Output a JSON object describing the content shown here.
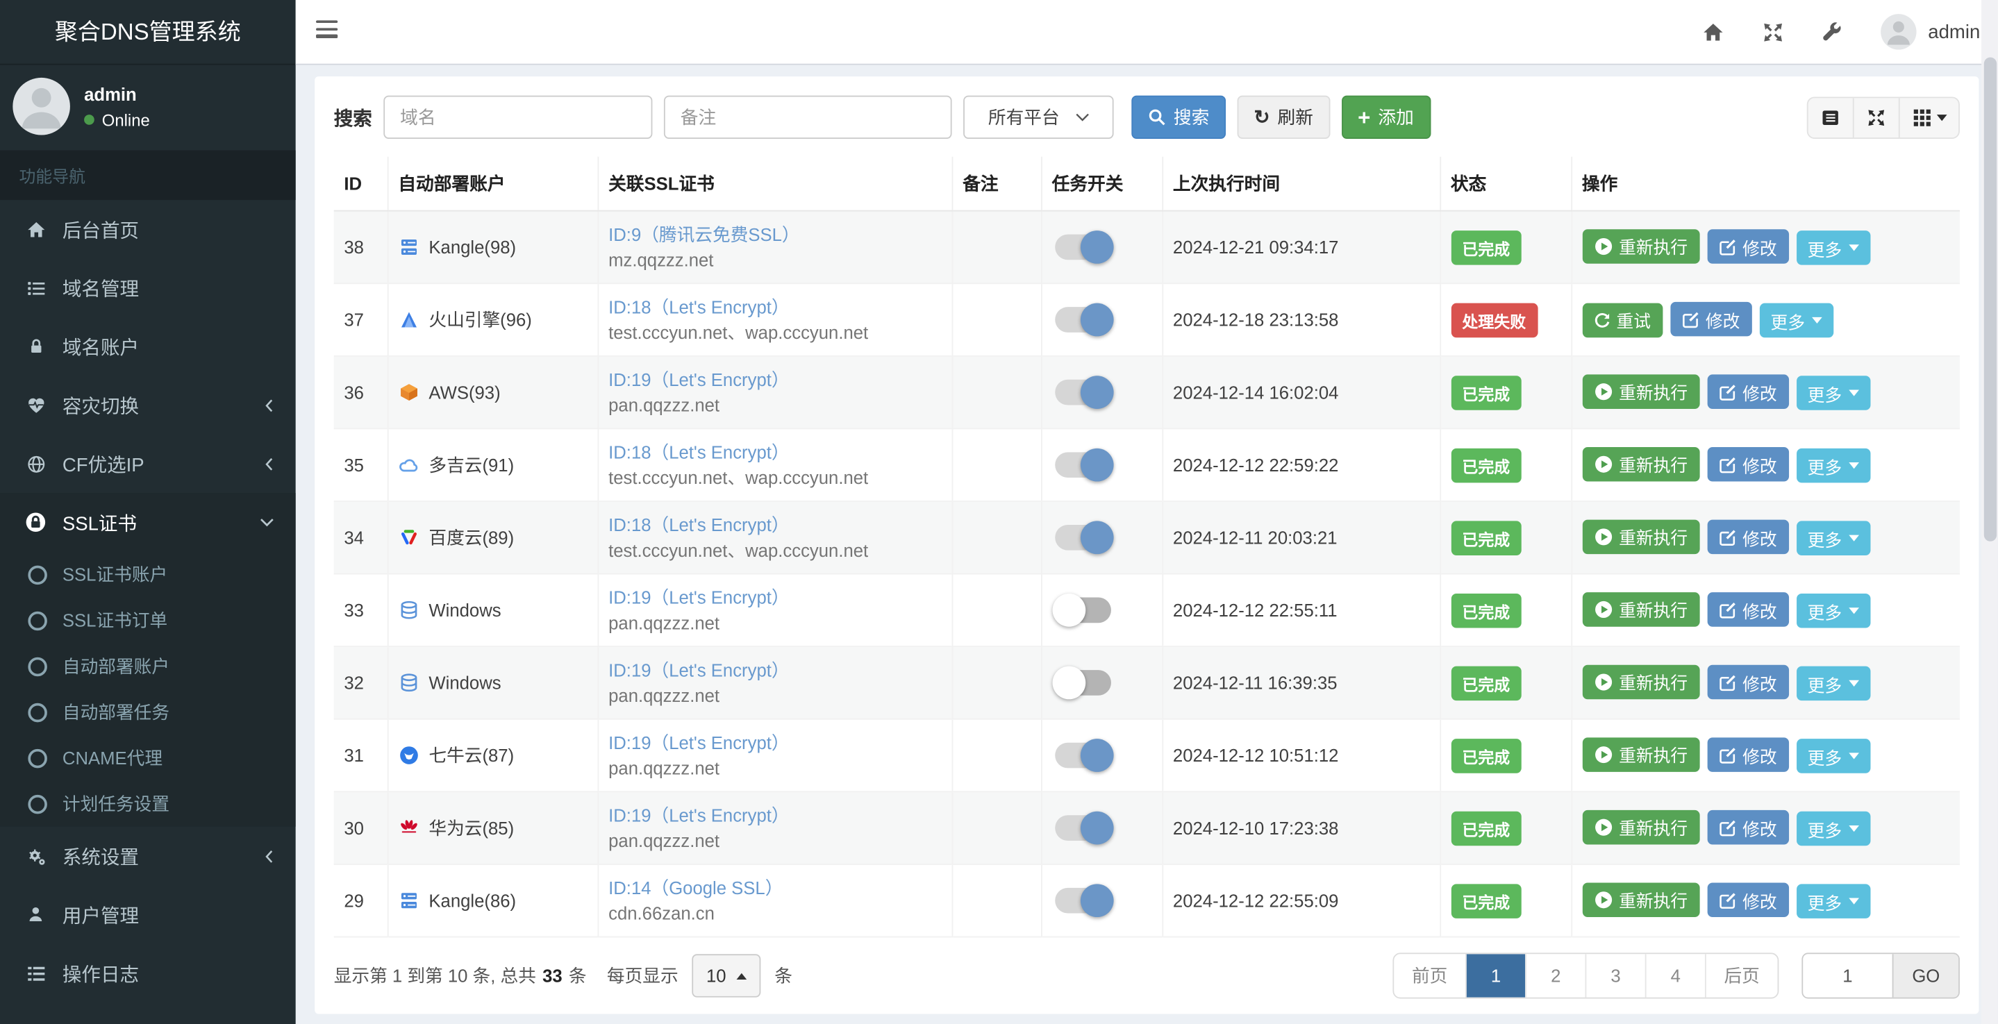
{
  "app": {
    "title": "聚合DNS管理系统"
  },
  "topbar": {
    "username": "admin",
    "icons": [
      "home",
      "fullscreen",
      "wrench"
    ]
  },
  "sidebar": {
    "user": {
      "name": "admin",
      "status": "Online"
    },
    "section_label": "功能导航",
    "items": [
      {
        "label": "后台首页",
        "icon": "home"
      },
      {
        "label": "域名管理",
        "icon": "list"
      },
      {
        "label": "域名账户",
        "icon": "lock"
      },
      {
        "label": "容灾切换",
        "icon": "heartbeat",
        "chevron": "left"
      },
      {
        "label": "CF优选IP",
        "icon": "globe",
        "chevron": "left"
      },
      {
        "label": "SSL证书",
        "icon": "ssl-lock",
        "chevron": "down",
        "active": true,
        "children": [
          "SSL证书账户",
          "SSL证书订单",
          "自动部署账户",
          "自动部署任务",
          "CNAME代理",
          "计划任务设置"
        ]
      },
      {
        "label": "系统设置",
        "icon": "gears",
        "chevron": "left"
      },
      {
        "label": "用户管理",
        "icon": "user"
      },
      {
        "label": "操作日志",
        "icon": "log"
      }
    ]
  },
  "search": {
    "label": "搜索",
    "domain_placeholder": "域名",
    "note_placeholder": "备注",
    "platform_selected": "所有平台",
    "search_button": "搜索",
    "refresh_button": "刷新",
    "add_button": "添加"
  },
  "view_toolbar": {
    "buttons": [
      "detail-view",
      "fullscreen",
      "columns"
    ]
  },
  "colors": {
    "success": "#5cb85c",
    "danger": "#d9534f",
    "info": "#5bc0de",
    "primary": "#5d8fc4",
    "link": "#6899ce",
    "active_page": "#3c6e9f"
  },
  "table": {
    "columns": [
      "ID",
      "自动部署账户",
      "关联SSL证书",
      "备注",
      "任务开关",
      "上次执行时间",
      "状态",
      "操作"
    ],
    "action_sets": {
      "default": [
        {
          "label": "重新执行",
          "style": "success",
          "icon": "play-circle",
          "name": "rerun-button"
        },
        {
          "label": "修改",
          "style": "primary",
          "icon": "edit",
          "name": "edit-button"
        },
        {
          "label": "更多",
          "style": "info",
          "icon": "caret-down",
          "name": "more-button"
        }
      ],
      "retry": [
        {
          "label": "重试",
          "style": "success",
          "icon": "refresh",
          "name": "retry-button"
        },
        {
          "label": "修改",
          "style": "primary",
          "icon": "edit",
          "name": "edit-button"
        },
        {
          "label": "更多",
          "style": "info",
          "icon": "caret-down",
          "name": "more-button"
        }
      ]
    },
    "rows": [
      {
        "id": "38",
        "account": "Kangle(98)",
        "account_icon": "kangle",
        "cert_link": "ID:9（腾讯云免费SSL）",
        "cert_domains": "mz.qqzzz.net",
        "note": "",
        "switch_on": true,
        "last_run": "2024-12-21 09:34:17",
        "status": "已完成",
        "status_type": "success",
        "actions": "default"
      },
      {
        "id": "37",
        "account": "火山引擎(96)",
        "account_icon": "volcengine",
        "cert_link": "ID:18（Let's Encrypt）",
        "cert_domains": "test.cccyun.net、wap.cccyun.net",
        "note": "",
        "switch_on": true,
        "last_run": "2024-12-18 23:13:58",
        "status": "处理失败",
        "status_type": "danger",
        "actions": "retry"
      },
      {
        "id": "36",
        "account": "AWS(93)",
        "account_icon": "aws",
        "cert_link": "ID:19（Let's Encrypt）",
        "cert_domains": "pan.qqzzz.net",
        "note": "",
        "switch_on": true,
        "last_run": "2024-12-14 16:02:04",
        "status": "已完成",
        "status_type": "success",
        "actions": "default"
      },
      {
        "id": "35",
        "account": "多吉云(91)",
        "account_icon": "dogecloud",
        "cert_link": "ID:18（Let's Encrypt）",
        "cert_domains": "test.cccyun.net、wap.cccyun.net",
        "note": "",
        "switch_on": true,
        "last_run": "2024-12-12 22:59:22",
        "status": "已完成",
        "status_type": "success",
        "actions": "default"
      },
      {
        "id": "34",
        "account": "百度云(89)",
        "account_icon": "baidu",
        "cert_link": "ID:18（Let's Encrypt）",
        "cert_domains": "test.cccyun.net、wap.cccyun.net",
        "note": "",
        "switch_on": true,
        "last_run": "2024-12-11 20:03:21",
        "status": "已完成",
        "status_type": "success",
        "actions": "default"
      },
      {
        "id": "33",
        "account": "Windows",
        "account_icon": "windows-db",
        "cert_link": "ID:19（Let's Encrypt）",
        "cert_domains": "pan.qqzzz.net",
        "note": "",
        "switch_on": false,
        "last_run": "2024-12-12 22:55:11",
        "status": "已完成",
        "status_type": "success",
        "actions": "default"
      },
      {
        "id": "32",
        "account": "Windows",
        "account_icon": "windows-db",
        "cert_link": "ID:19（Let's Encrypt）",
        "cert_domains": "pan.qqzzz.net",
        "note": "",
        "switch_on": false,
        "last_run": "2024-12-11 16:39:35",
        "status": "已完成",
        "status_type": "success",
        "actions": "default"
      },
      {
        "id": "31",
        "account": "七牛云(87)",
        "account_icon": "qiniu",
        "cert_link": "ID:19（Let's Encrypt）",
        "cert_domains": "pan.qqzzz.net",
        "note": "",
        "switch_on": true,
        "last_run": "2024-12-12 10:51:12",
        "status": "已完成",
        "status_type": "success",
        "actions": "default"
      },
      {
        "id": "30",
        "account": "华为云(85)",
        "account_icon": "huawei",
        "cert_link": "ID:19（Let's Encrypt）",
        "cert_domains": "pan.qqzzz.net",
        "note": "",
        "switch_on": true,
        "last_run": "2024-12-10 17:23:38",
        "status": "已完成",
        "status_type": "success",
        "actions": "default"
      },
      {
        "id": "29",
        "account": "Kangle(86)",
        "account_icon": "kangle",
        "cert_link": "ID:14（Google SSL）",
        "cert_domains": "cdn.66zan.cn",
        "note": "",
        "switch_on": true,
        "last_run": "2024-12-12 22:55:09",
        "status": "已完成",
        "status_type": "success",
        "actions": "default"
      }
    ]
  },
  "pagination": {
    "info_prefix": "显示第 1 到第 10 条, 总共",
    "total": "33",
    "info_suffix": "条",
    "per_page_label": "每页显示",
    "per_page_value": "10",
    "per_page_unit": "条",
    "pages": [
      {
        "label": "前页",
        "active": false
      },
      {
        "label": "1",
        "active": true
      },
      {
        "label": "2",
        "active": false
      },
      {
        "label": "3",
        "active": false
      },
      {
        "label": "4",
        "active": false
      },
      {
        "label": "后页",
        "active": false
      }
    ],
    "goto_value": "1",
    "go_label": "GO"
  }
}
